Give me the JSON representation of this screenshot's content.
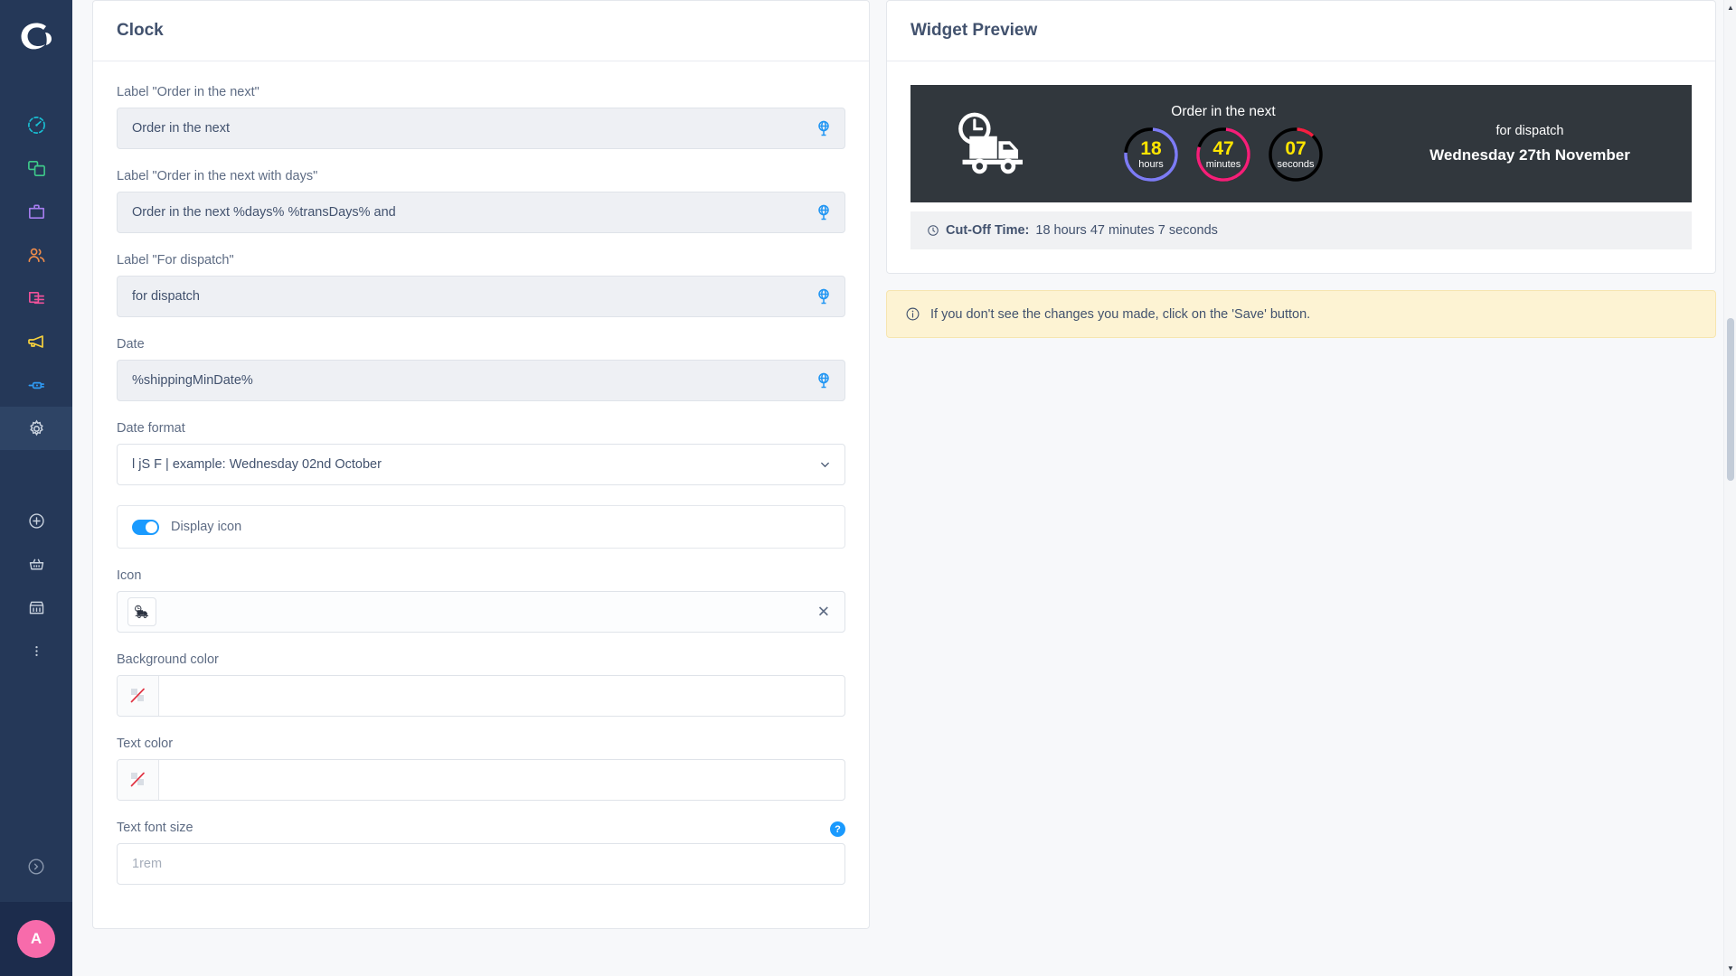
{
  "sidebar": {
    "logo": "crescent-logo",
    "items": [
      {
        "name": "dashboard",
        "icon": "gauge-icon",
        "color": "#19c0d4",
        "active": false
      },
      {
        "name": "catalog",
        "icon": "copy-icon",
        "color": "#3ec98a",
        "active": false
      },
      {
        "name": "orders",
        "icon": "briefcase-icon",
        "color": "#a67ef0",
        "active": false
      },
      {
        "name": "customers",
        "icon": "users-icon",
        "color": "#f08c4a",
        "active": false
      },
      {
        "name": "content",
        "icon": "pages-icon",
        "color": "#f0519a",
        "active": false
      },
      {
        "name": "marketing",
        "icon": "megaphone-icon",
        "color": "#f7d13c",
        "active": false
      },
      {
        "name": "modules",
        "icon": "plug-icon",
        "color": "#2f9bf5",
        "active": false
      },
      {
        "name": "settings",
        "icon": "gear-icon",
        "color": "#c9d2de",
        "active": true
      }
    ],
    "secondary_items": [
      {
        "name": "add",
        "icon": "plus-circle-icon",
        "color": "#c9d2de"
      },
      {
        "name": "basket",
        "icon": "basket-icon",
        "color": "#c9d2de"
      },
      {
        "name": "store",
        "icon": "store-icon",
        "color": "#c9d2de"
      },
      {
        "name": "more",
        "icon": "more-vertical-icon",
        "color": "#c9d2de"
      }
    ],
    "collapse_icon": "chevron-right-circle-icon",
    "avatar_initial": "A",
    "avatar_color": "#f76bab",
    "background_color": "#253858"
  },
  "left_panel": {
    "title": "Clock",
    "fields": {
      "label_order_next": {
        "label": "Label \"Order in the next\"",
        "value": "Order in the next",
        "icon": "globe-translate-icon"
      },
      "label_order_next_days": {
        "label": "Label \"Order in the next with days\"",
        "value": "Order in the next %days% %transDays% and",
        "icon": "globe-translate-icon"
      },
      "label_for_dispatch": {
        "label": "Label \"For dispatch\"",
        "value": "for dispatch",
        "icon": "globe-translate-icon"
      },
      "date": {
        "label": "Date",
        "value": "%shippingMinDate%",
        "icon": "globe-translate-icon"
      },
      "date_format": {
        "label": "Date format",
        "value": "l jS F | example: Wednesday 02nd October",
        "icon": "chevron-down-icon"
      },
      "display_icon_toggle": {
        "label": "Display icon",
        "enabled": true,
        "accent": "#1a9afe"
      },
      "icon": {
        "label": "Icon",
        "value": "",
        "chip_icon": "truck-clock-icon",
        "clear_icon": "close-icon"
      },
      "background_color": {
        "label": "Background color",
        "value": "",
        "swatch": "transparent-no-color"
      },
      "text_color": {
        "label": "Text color",
        "value": "",
        "swatch": "transparent-no-color"
      },
      "text_font_size": {
        "label": "Text font size",
        "value": "",
        "placeholder": "1rem",
        "help_icon": "question-mark-icon"
      }
    }
  },
  "right_panel": {
    "title": "Widget Preview",
    "widget": {
      "background_color": "#31373d",
      "truck_icon": "truck-clock-icon",
      "headline": "Order in the next",
      "counters": [
        {
          "value": "18",
          "unit": "hours",
          "color": "#7d7cf5",
          "progress": 0.75
        },
        {
          "value": "47",
          "unit": "minutes",
          "color": "#f51f78",
          "progress": 0.78
        },
        {
          "value": "07",
          "unit": "seconds",
          "color": "#f51f41",
          "progress": 0.11
        }
      ],
      "dispatch_label": "for dispatch",
      "dispatch_date": "Wednesday 27th November",
      "number_color": "#ffe500",
      "ring_track_color": "#000000"
    },
    "cutoff": {
      "icon": "clock-icon",
      "label": "Cut-Off Time:",
      "value": "18 hours 47 minutes 7 seconds"
    },
    "alert": {
      "icon": "info-circle-icon",
      "message": "If you don't see the changes you made, click on the 'Save' button.",
      "background_color": "#fdf3d3"
    }
  }
}
